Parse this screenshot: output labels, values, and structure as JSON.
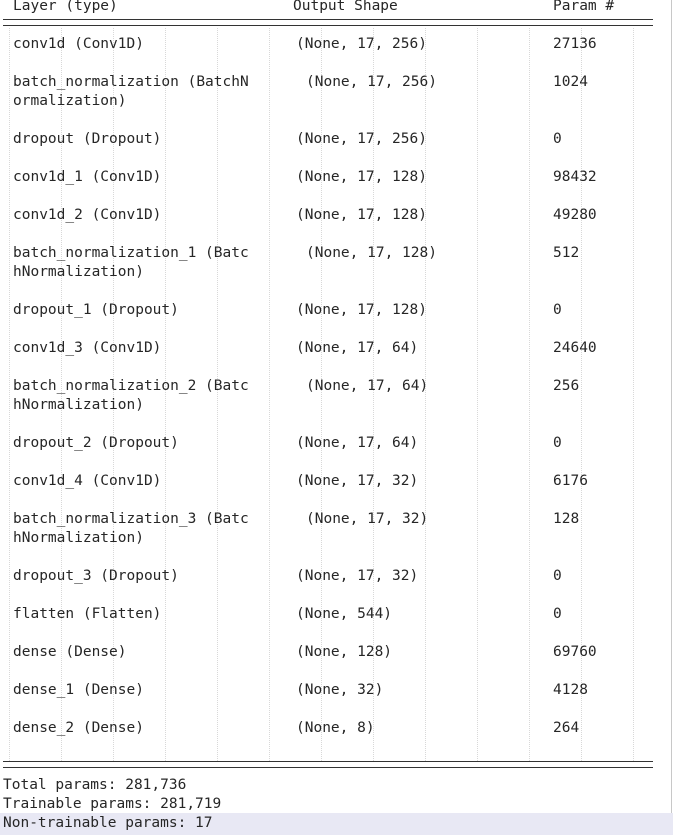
{
  "header": {
    "layer_col": "Layer (type)",
    "shape_col": "Output Shape",
    "param_col": "Param #"
  },
  "rows": [
    {
      "layer": "conv1d (Conv1D)",
      "shape": "(None, 17, 256)",
      "params": "27136"
    },
    {
      "layer": "batch_normalization (BatchN\normalization)",
      "shape": "(None, 17, 256)",
      "params": "1024"
    },
    {
      "layer": "dropout (Dropout)",
      "shape": "(None, 17, 256)",
      "params": "0"
    },
    {
      "layer": "conv1d_1 (Conv1D)",
      "shape": "(None, 17, 128)",
      "params": "98432"
    },
    {
      "layer": "conv1d_2 (Conv1D)",
      "shape": "(None, 17, 128)",
      "params": "49280"
    },
    {
      "layer": "batch_normalization_1 (Batc\nhNormalization)",
      "shape": "(None, 17, 128)",
      "params": "512"
    },
    {
      "layer": "dropout_1 (Dropout)",
      "shape": "(None, 17, 128)",
      "params": "0"
    },
    {
      "layer": "conv1d_3 (Conv1D)",
      "shape": "(None, 17, 64)",
      "params": "24640"
    },
    {
      "layer": "batch_normalization_2 (Batc\nhNormalization)",
      "shape": "(None, 17, 64)",
      "params": "256"
    },
    {
      "layer": "dropout_2 (Dropout)",
      "shape": "(None, 17, 64)",
      "params": "0"
    },
    {
      "layer": "conv1d_4 (Conv1D)",
      "shape": "(None, 17, 32)",
      "params": "6176"
    },
    {
      "layer": "batch_normalization_3 (Batc\nhNormalization)",
      "shape": "(None, 17, 32)",
      "params": "128"
    },
    {
      "layer": "dropout_3 (Dropout)",
      "shape": "(None, 17, 32)",
      "params": "0"
    },
    {
      "layer": "flatten (Flatten)",
      "shape": "(None, 544)",
      "params": "0"
    },
    {
      "layer": "dense (Dense)",
      "shape": "(None, 128)",
      "params": "69760"
    },
    {
      "layer": "dense_1 (Dense)",
      "shape": "(None, 32)",
      "params": "4128"
    },
    {
      "layer": "dense_2 (Dense)",
      "shape": "(None, 8)",
      "params": "264"
    }
  ],
  "footer": {
    "total": "Total params: 281,736",
    "trainable": "Trainable params: 281,719",
    "non_trainable": "Non-trainable params: 17"
  }
}
